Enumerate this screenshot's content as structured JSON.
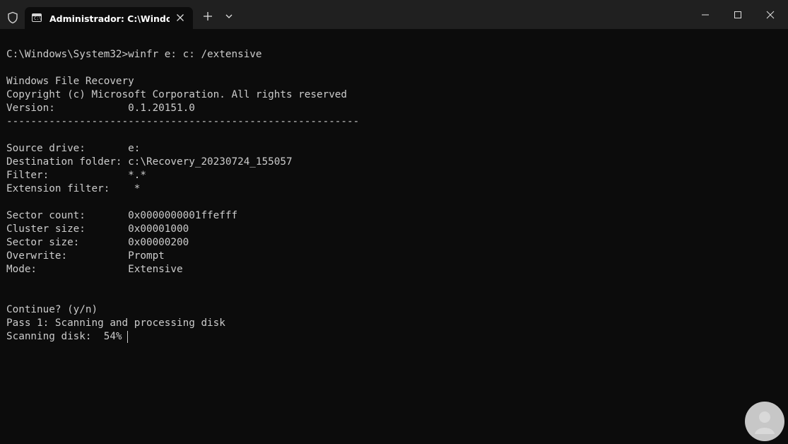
{
  "window": {
    "tab_title": "Administrador: C:\\Windows\\S",
    "tab_icon_glyph": "C:\\",
    "icons": {
      "shield": "shield-icon",
      "close_tab": "close-icon",
      "new_tab": "plus-icon",
      "dropdown": "chevron-down-icon",
      "minimize": "minimize-icon",
      "maximize": "maximize-icon",
      "close_window": "close-icon"
    },
    "colors": {
      "titlebar": "#202020",
      "background": "#0c0c0c",
      "text": "#cccccc"
    }
  },
  "terminal": {
    "lines": [
      "C:\\Windows\\System32>winfr e: c: /extensive",
      "",
      "Windows File Recovery",
      "Copyright (c) Microsoft Corporation. All rights reserved",
      "Version:            0.1.20151.0",
      "----------------------------------------------------------",
      "",
      "Source drive:       e:",
      "Destination folder: c:\\Recovery_20230724_155057",
      "Filter:             *.*",
      "Extension filter:    *",
      "",
      "Sector count:       0x0000000001ffefff",
      "Cluster size:       0x00001000",
      "Sector size:        0x00000200",
      "Overwrite:          Prompt",
      "Mode:               Extensive",
      "",
      "",
      "Continue? (y/n)",
      "Pass 1: Scanning and processing disk",
      "Scanning disk:  54%"
    ]
  }
}
